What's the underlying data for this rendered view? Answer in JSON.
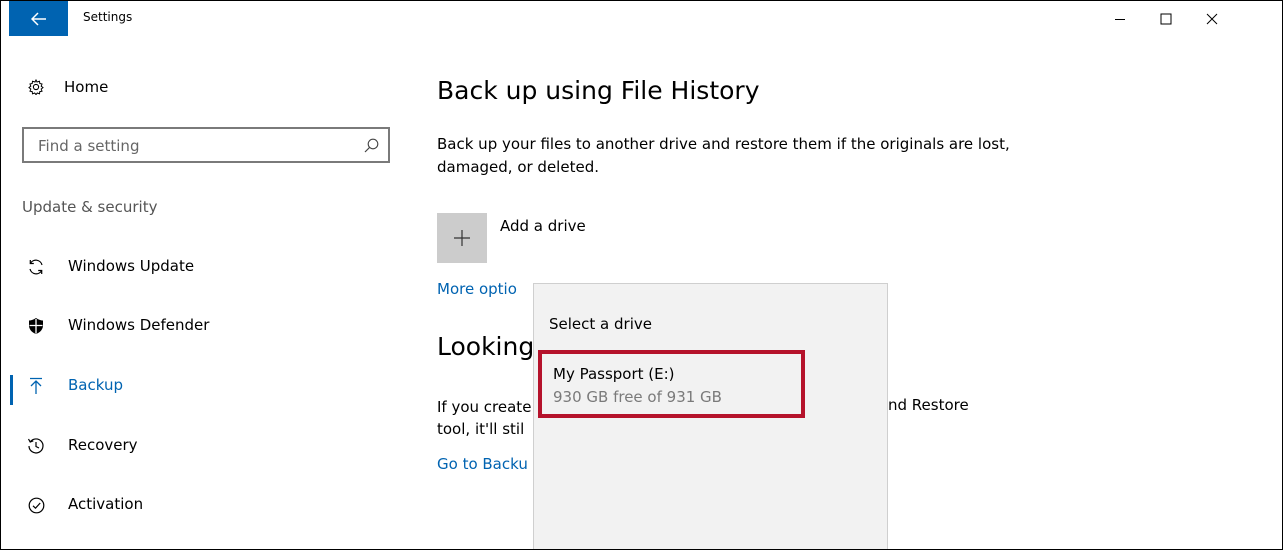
{
  "window": {
    "title": "Settings",
    "controls": [
      "minimize-icon",
      "maximize-icon",
      "close-icon"
    ]
  },
  "sidebar": {
    "home_label": "Home",
    "search_placeholder": "Find a setting",
    "section_label": "Update & security",
    "items": [
      {
        "label": "Windows Update",
        "icon": "sync-icon",
        "selected": false
      },
      {
        "label": "Windows Defender",
        "icon": "shield-icon",
        "selected": false
      },
      {
        "label": "Backup",
        "icon": "backup-arrow-icon",
        "selected": true
      },
      {
        "label": "Recovery",
        "icon": "history-icon",
        "selected": false
      },
      {
        "label": "Activation",
        "icon": "check-circle-icon",
        "selected": false
      }
    ]
  },
  "main": {
    "title": "Back up using File History",
    "description": "Back up your files to another drive and restore them if the originals are lost, damaged, or deleted.",
    "add_drive_label": "Add a drive",
    "more_options_visible": "More optio",
    "looking_visible": "Looking",
    "if_text_line1_visible": "If you create",
    "if_text_line2_visible": "tool, it'll stil",
    "if_text_right_visible": "nd Restore",
    "go_link_visible": "Go to Backu"
  },
  "flyout": {
    "title": "Select a drive",
    "drive": {
      "name": "My Passport (E:)",
      "size": "930 GB free of 931 GB"
    }
  },
  "colors": {
    "accent": "#0063b1",
    "highlight_border": "#b5122b"
  }
}
